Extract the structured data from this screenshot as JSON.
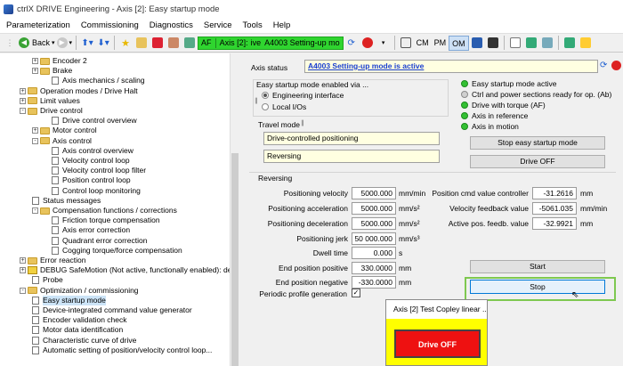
{
  "window": {
    "title": "ctrlX DRIVE Engineering - Axis [2]: Easy startup mode"
  },
  "menubar": {
    "items": [
      "Parameterization",
      "Commissioning",
      "Diagnostics",
      "Service",
      "Tools",
      "Help"
    ]
  },
  "toolbar": {
    "back_label": "Back",
    "status_af": "AF",
    "status_axis": "Axis [2]:",
    "status_mode": "ive",
    "status_message": "A4003 Setting-up mo",
    "mode_cm": "CM",
    "mode_pm": "PM",
    "mode_om": "OM",
    "active_mode": "OM"
  },
  "tree": {
    "items": [
      {
        "label": "Encoder 2",
        "type": "folder",
        "expand": "+"
      },
      {
        "label": "Brake",
        "type": "folder",
        "expand": "+"
      },
      {
        "label": "Axis mechanics / scaling",
        "type": "doc"
      },
      {
        "label": "Operation modes / Drive Halt",
        "type": "folder",
        "expand": "+"
      },
      {
        "label": "Limit values",
        "type": "folder",
        "expand": "+"
      },
      {
        "label": "Drive control",
        "type": "folder",
        "expand": "-"
      },
      {
        "label": "Drive control overview",
        "type": "doc"
      },
      {
        "label": "Motor control",
        "type": "folder",
        "expand": "+"
      },
      {
        "label": "Axis control",
        "type": "folder",
        "expand": "-"
      },
      {
        "label": "Axis control overview",
        "type": "doc"
      },
      {
        "label": "Velocity control loop",
        "type": "doc"
      },
      {
        "label": "Velocity control loop filter",
        "type": "doc"
      },
      {
        "label": "Position control loop",
        "type": "doc"
      },
      {
        "label": "Control loop monitoring",
        "type": "doc"
      },
      {
        "label": "Status messages",
        "type": "doc"
      },
      {
        "label": "Compensation functions / corrections",
        "type": "folder",
        "expand": "-"
      },
      {
        "label": "Friction torque compensation",
        "type": "doc"
      },
      {
        "label": "Axis error correction",
        "type": "doc"
      },
      {
        "label": "Quadrant error correction",
        "type": "doc"
      },
      {
        "label": "Cogging torque/force compensation",
        "type": "doc"
      },
      {
        "label": "Error reaction",
        "type": "folder",
        "expand": "+"
      },
      {
        "label": "DEBUG SafeMotion (Not active, functionally enabled): def",
        "type": "warn",
        "expand": "+"
      },
      {
        "label": "Probe",
        "type": "doc"
      },
      {
        "label": "Optimization / commissioning",
        "type": "folder",
        "expand": "-"
      },
      {
        "label": "Easy startup mode",
        "type": "doc",
        "selected": true
      },
      {
        "label": "Device-integrated command value generator",
        "type": "doc"
      },
      {
        "label": "Encoder validation check",
        "type": "doc"
      },
      {
        "label": "Motor data identification",
        "type": "doc"
      },
      {
        "label": "Characteristic curve of drive",
        "type": "doc"
      },
      {
        "label": "Automatic setting of position/velocity control loop...",
        "type": "doc"
      }
    ]
  },
  "panel": {
    "axis_status_label": "Axis status",
    "axis_status_value": "A4003 Setting-up mode is active",
    "enabled_via_label": "Easy startup mode enabled via ...",
    "enabled_via_options": [
      "Engineering interface",
      "Local I/Os"
    ],
    "travel_mode_label": "Travel mode",
    "travel_mode_values": [
      "Drive-controlled positioning",
      "Reversing"
    ],
    "leds": [
      {
        "label": "Easy startup mode active",
        "state": "green"
      },
      {
        "label": "Ctrl and power sections ready for op. (Ab)",
        "state": "gray"
      },
      {
        "label": "Drive with torque (AF)",
        "state": "green"
      },
      {
        "label": "Axis in reference",
        "state": "green"
      },
      {
        "label": "Axis in motion",
        "state": "green"
      }
    ],
    "stop_easy_button": "Stop easy startup mode",
    "drive_off_button": "Drive OFF",
    "reversing_label": "Reversing",
    "params": [
      {
        "label": "Positioning velocity",
        "value": "5000.000",
        "unit": "mm/min"
      },
      {
        "label": "Positioning acceleration",
        "value": "5000.000",
        "unit": "mm/s²"
      },
      {
        "label": "Positioning deceleration",
        "value": "5000.000",
        "unit": "mm/s²"
      },
      {
        "label": "Positioning jerk",
        "value": "50 000.000",
        "unit": "mm/s³"
      },
      {
        "label": "Dwell time",
        "value": "0.000",
        "unit": "s"
      },
      {
        "label": "End position positive",
        "value": "330.0000",
        "unit": "mm"
      },
      {
        "label": "End position negative",
        "value": "-330.0000",
        "unit": "mm"
      }
    ],
    "periodic_label": "Periodic profile generation",
    "readouts": [
      {
        "label": "Position cmd value controller",
        "value": "-31.2616",
        "unit": "mm"
      },
      {
        "label": "Velocity feedback value",
        "value": "-5061.035",
        "unit": "mm/min"
      },
      {
        "label": "Active pos. feedb. value",
        "value": "-32.9921",
        "unit": "mm"
      }
    ],
    "start_button": "Start",
    "stop_button": "Stop"
  },
  "popup": {
    "title": "Axis [2] Test Copley linear ...",
    "drive_off": "Drive OFF"
  }
}
